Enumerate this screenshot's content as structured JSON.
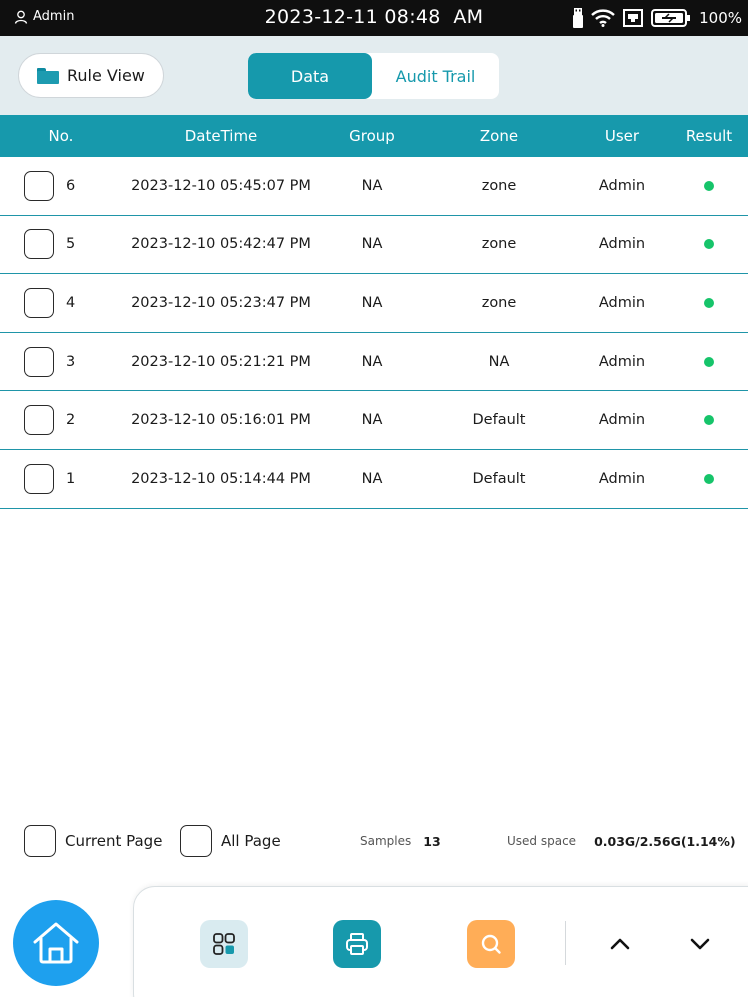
{
  "status_bar": {
    "user": "Admin",
    "datetime": "2023-12-11 08:48  AM",
    "battery": "100%"
  },
  "toolbar": {
    "rule_view_label": "Rule View",
    "tabs": [
      {
        "label": "Data",
        "active": true
      },
      {
        "label": "Audit Trail",
        "active": false
      }
    ]
  },
  "table": {
    "columns": [
      "No.",
      "DateTime",
      "Group",
      "Zone",
      "User",
      "Result"
    ],
    "rows": [
      {
        "no": "6",
        "datetime": "2023-12-10 05:45:07 PM",
        "group": "NA",
        "zone": "zone",
        "user": "Admin",
        "result": "pass"
      },
      {
        "no": "5",
        "datetime": "2023-12-10 05:42:47 PM",
        "group": "NA",
        "zone": "zone",
        "user": "Admin",
        "result": "pass"
      },
      {
        "no": "4",
        "datetime": "2023-12-10 05:23:47 PM",
        "group": "NA",
        "zone": "zone",
        "user": "Admin",
        "result": "pass"
      },
      {
        "no": "3",
        "datetime": "2023-12-10 05:21:21 PM",
        "group": "NA",
        "zone": "NA",
        "user": "Admin",
        "result": "pass"
      },
      {
        "no": "2",
        "datetime": "2023-12-10 05:16:01 PM",
        "group": "NA",
        "zone": "Default",
        "user": "Admin",
        "result": "pass"
      },
      {
        "no": "1",
        "datetime": "2023-12-10 05:14:44 PM",
        "group": "NA",
        "zone": "Default",
        "user": "Admin",
        "result": "pass"
      }
    ]
  },
  "footer": {
    "current_page_label": "Current Page",
    "all_page_label": "All Page",
    "samples_label": "Samples",
    "samples_value": "13",
    "used_space_label": "Used space",
    "used_space_value": "0.03G/2.56G(1.14%)"
  },
  "dock": {
    "icons": [
      "home-icon",
      "grid-icon",
      "print-icon",
      "search-icon",
      "chevron-up-icon",
      "chevron-down-icon"
    ]
  },
  "colors": {
    "accent": "#1799ac",
    "top_area_bg": "#e3ecef",
    "result_ok": "#16c46a",
    "home_button": "#1ea0ee",
    "grid_button": "#d9ebf0",
    "print_button": "#1799ac",
    "search_button": "#ffad57"
  }
}
